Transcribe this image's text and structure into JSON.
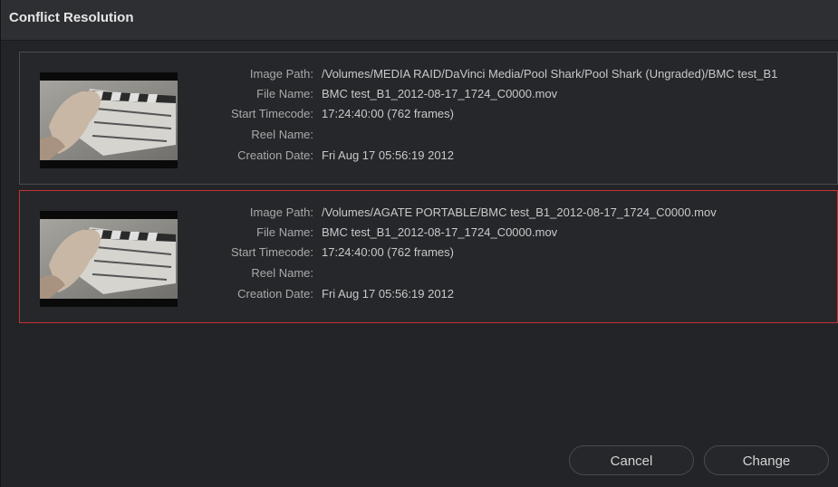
{
  "dialog": {
    "title": "Conflict Resolution"
  },
  "labels": {
    "image_path": "Image Path:",
    "file_name": "File Name:",
    "start_timecode": "Start Timecode:",
    "reel_name": "Reel Name:",
    "creation_date": "Creation Date:"
  },
  "clips": [
    {
      "image_path": "/Volumes/MEDIA RAID/DaVinci Media/Pool Shark/Pool Shark (Ungraded)/BMC test_B1",
      "file_name": "BMC test_B1_2012-08-17_1724_C0000.mov",
      "start_timecode": "17:24:40:00 (762 frames)",
      "reel_name": "",
      "creation_date": "Fri Aug 17 05:56:19 2012",
      "selected": false
    },
    {
      "image_path": "/Volumes/AGATE PORTABLE/BMC test_B1_2012-08-17_1724_C0000.mov",
      "file_name": "BMC test_B1_2012-08-17_1724_C0000.mov",
      "start_timecode": "17:24:40:00 (762 frames)",
      "reel_name": "",
      "creation_date": "Fri Aug 17 05:56:19 2012",
      "selected": true
    }
  ],
  "buttons": {
    "cancel": "Cancel",
    "change": "Change"
  },
  "colors": {
    "selection_border": "#c83236",
    "panel_background": "#232427"
  }
}
